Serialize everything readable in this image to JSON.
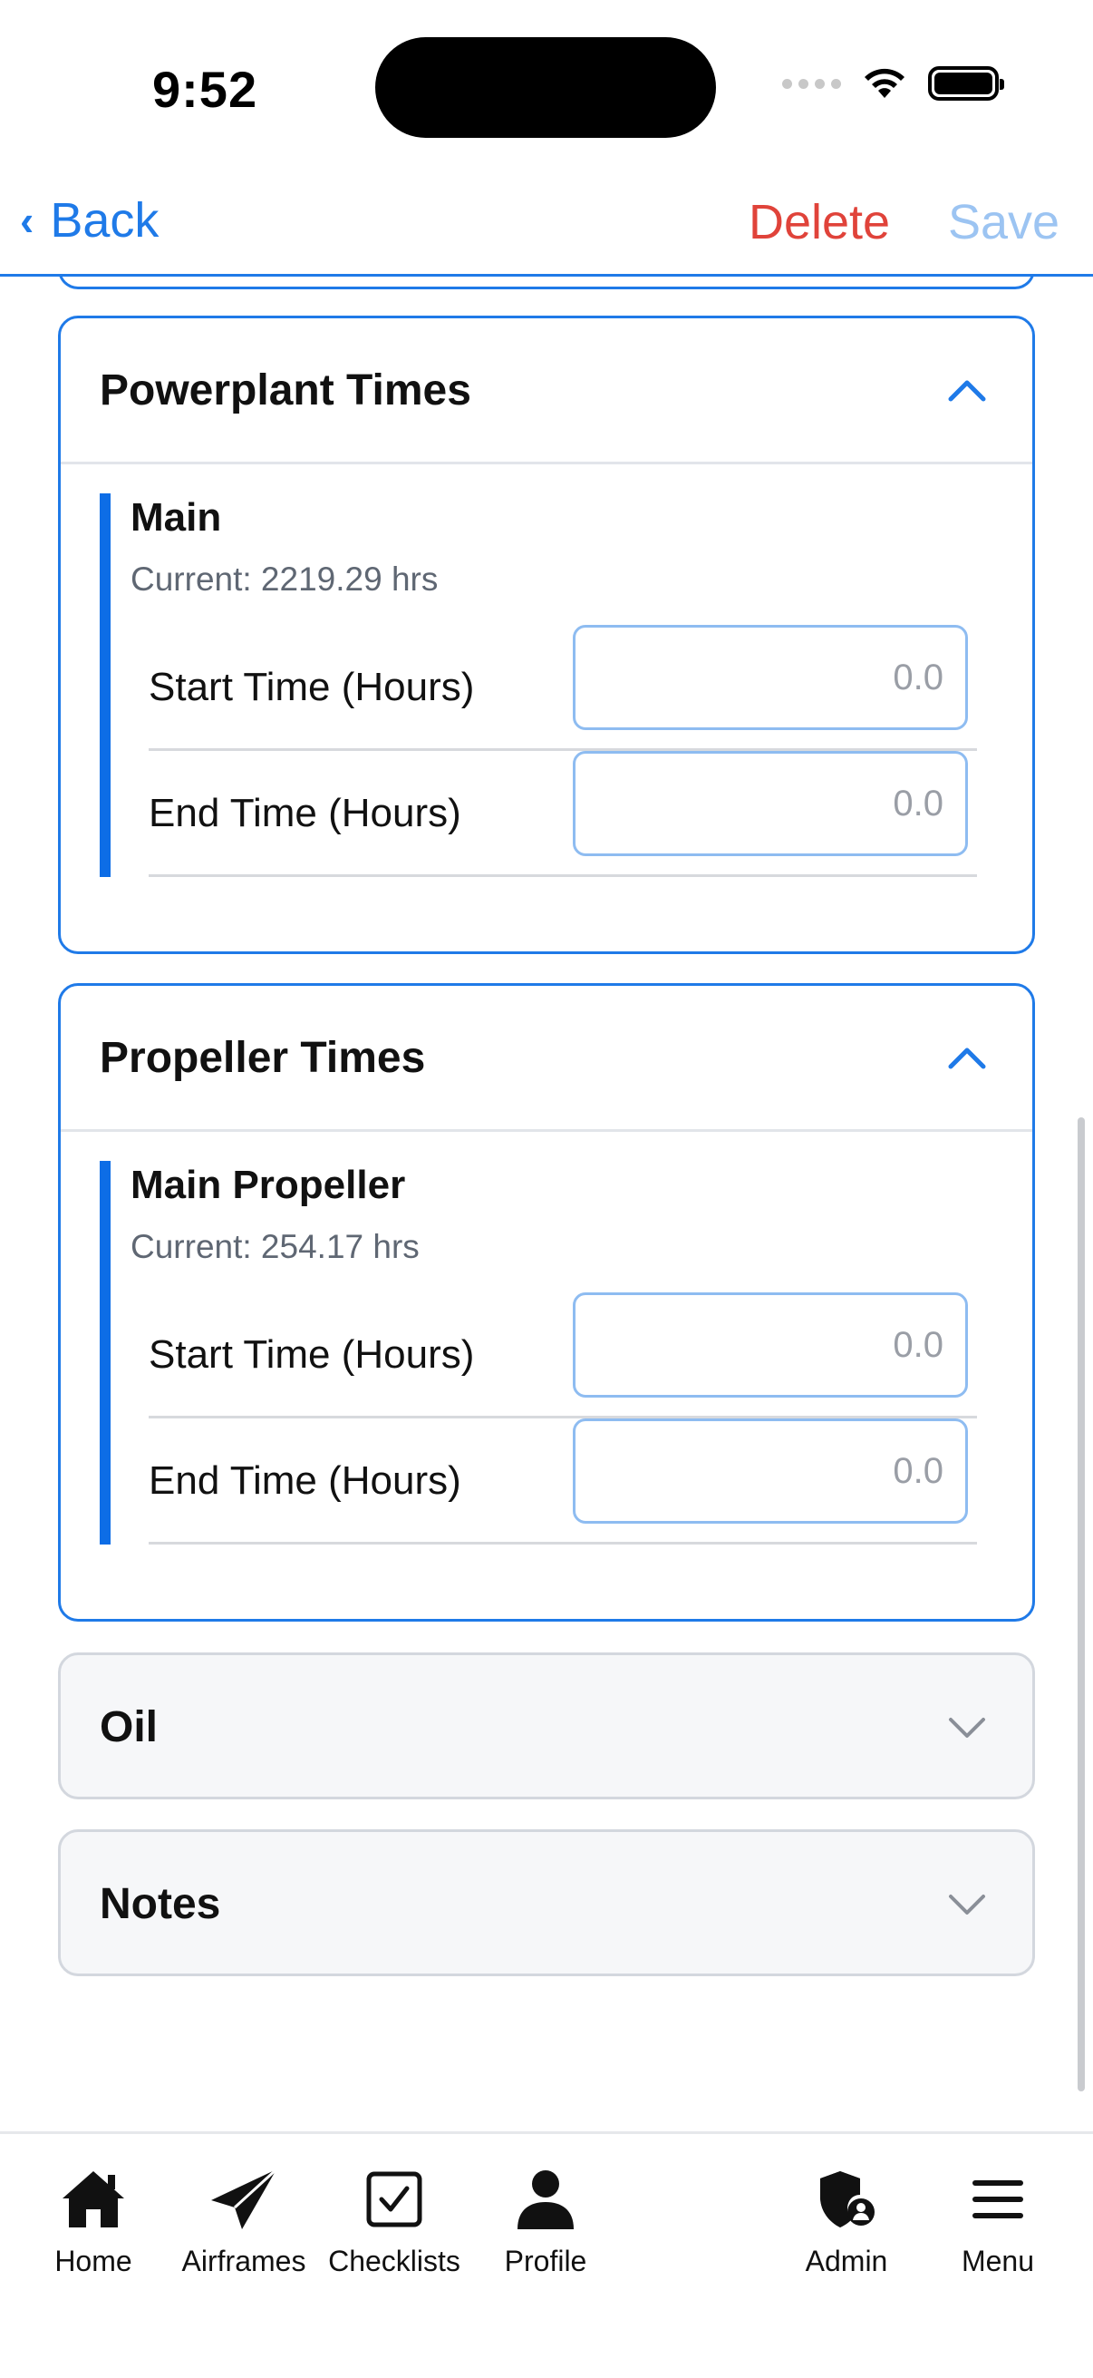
{
  "status_bar": {
    "time": "9:52"
  },
  "header": {
    "back_label": "Back",
    "delete_label": "Delete",
    "save_label": "Save"
  },
  "sections": {
    "powerplant": {
      "title": "Powerplant Times",
      "expanded": true,
      "item": {
        "name": "Main",
        "current": "Current: 2219.29 hrs",
        "start_label": "Start Time (Hours)",
        "start_placeholder": "0.0",
        "end_label": "End Time (Hours)",
        "end_placeholder": "0.0"
      }
    },
    "propeller": {
      "title": "Propeller Times",
      "expanded": true,
      "item": {
        "name": "Main Propeller",
        "current": "Current: 254.17 hrs",
        "start_label": "Start Time (Hours)",
        "start_placeholder": "0.0",
        "end_label": "End Time (Hours)",
        "end_placeholder": "0.0"
      }
    },
    "oil": {
      "title": "Oil",
      "expanded": false
    },
    "notes": {
      "title": "Notes",
      "expanded": false
    }
  },
  "tab_bar": {
    "items": [
      {
        "label": "Home",
        "icon": "home-icon"
      },
      {
        "label": "Airframes",
        "icon": "paper-plane-icon"
      },
      {
        "label": "Checklists",
        "icon": "checkbox-icon"
      },
      {
        "label": "Profile",
        "icon": "person-icon"
      },
      {
        "label": "Admin",
        "icon": "admin-shield-icon"
      },
      {
        "label": "Menu",
        "icon": "hamburger-menu-icon"
      }
    ]
  },
  "colors": {
    "accent": "#1f7ae8",
    "item_bar": "#0d6de6",
    "delete": "#e0433a",
    "save_disabled": "#9cc4f2",
    "collapsed_border": "#d3d7de",
    "collapsed_bg": "#f6f7f9"
  }
}
